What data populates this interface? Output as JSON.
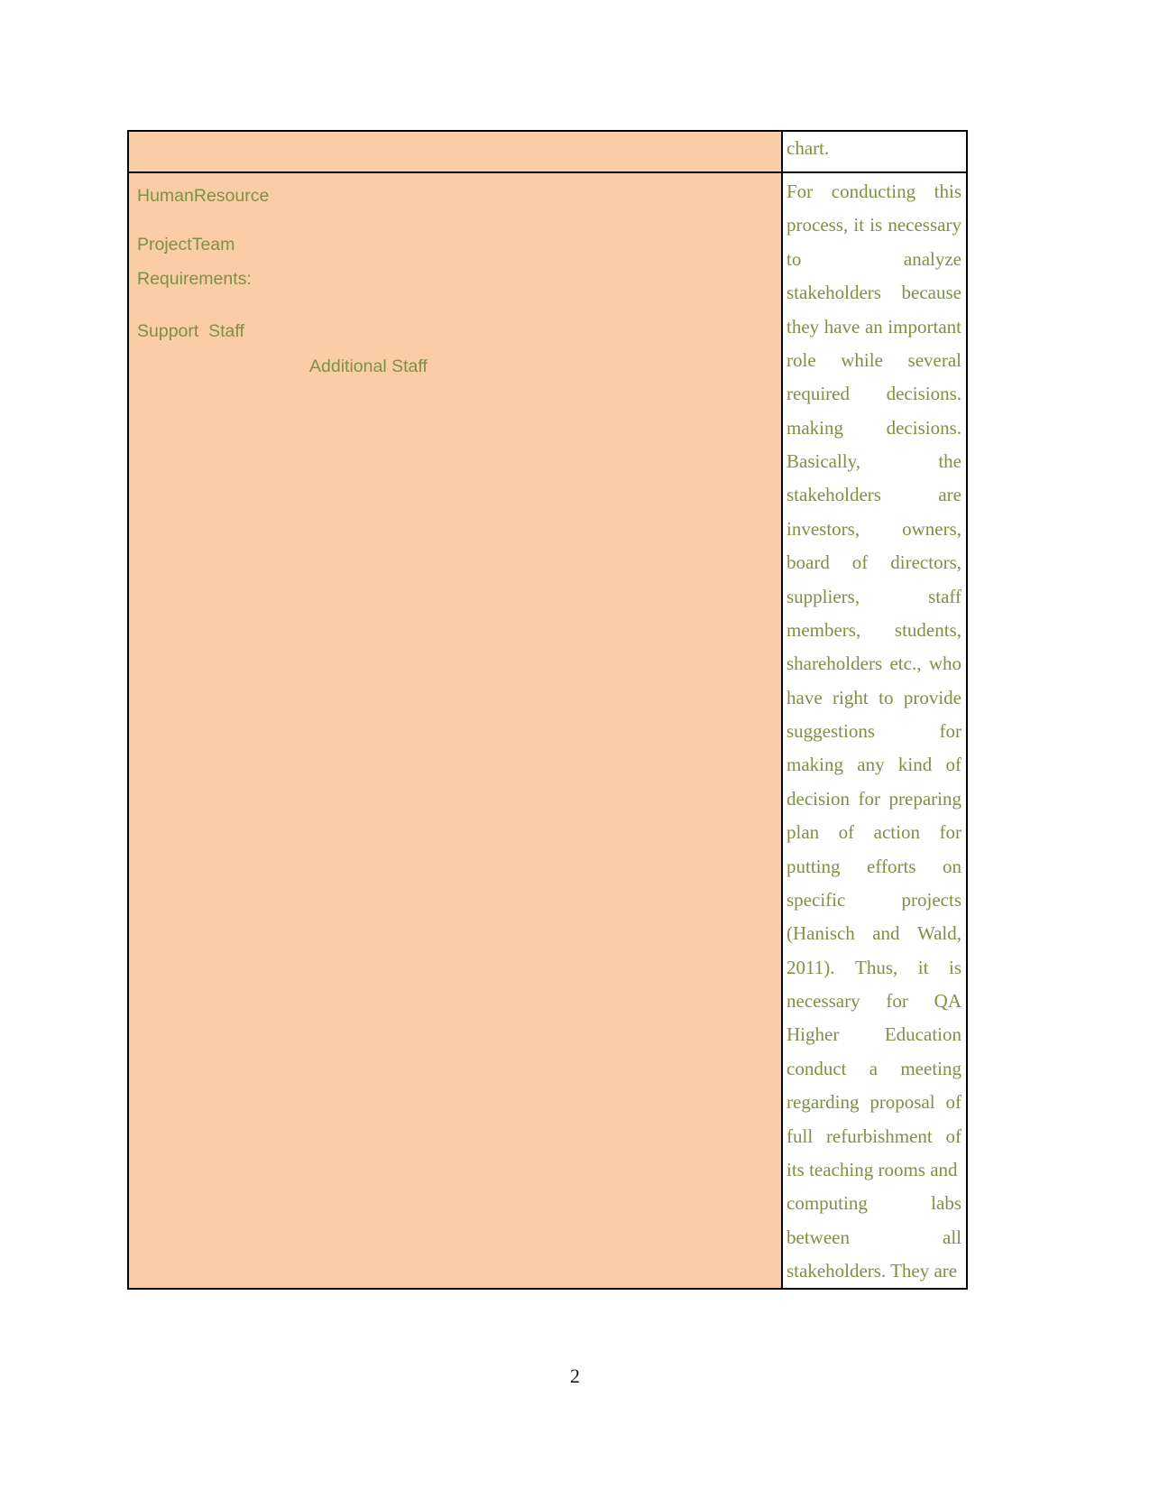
{
  "document": {
    "page_number": "2",
    "colors": {
      "cell_fill": "#facda7",
      "text_green": "#7e9045",
      "border": "#000000",
      "page_background": "#ffffff"
    }
  },
  "table": {
    "rows": [
      {
        "row_name": "header-row",
        "left_cell": {
          "text": ""
        },
        "right_cell": {
          "lines": [
            "chart."
          ]
        }
      },
      {
        "row_name": "body-row",
        "left_cell": {
          "entries": [
            {
              "label_a": "Human",
              "label_b": "Resource"
            },
            {
              "label_a": "Project",
              "label_b": "Team"
            },
            {
              "label_a": "Requirements:",
              "label_b": ""
            },
            {
              "label_a": "Support  Staff",
              "label_b": ""
            },
            {
              "label_a": "",
              "label_b": "Additional Staff"
            }
          ],
          "line_1": "Human",
          "line_1b": "Resource",
          "line_2": "Project",
          "line_2b": "Team",
          "line_3": "Requirements:",
          "line_4": "Support  Staff",
          "line_5": "Additional Staff"
        },
        "right_cell": {
          "paragraph": "For conducting this process, it is necessary to analyze stakeholders because they have an important role while several required decisions. making decisions. Basically, the stakeholders are investors, owners, board of directors, suppliers, staff members, students, shareholders etc., who have right to provide suggestions for making any kind of decision for preparing plan of action for putting efforts on specific projects (Hanisch and Wald, 2011). Thus, it is necessary for QA Higher Education conduct a meeting regarding proposal of full refurbishment of its teaching rooms and computing labs between all stakeholders. They are",
          "lines": [
            [
              "For",
              "conducting",
              "this"
            ],
            [
              "process,",
              "it",
              "is",
              "necessary"
            ],
            [
              "to",
              "analyze"
            ],
            [
              "stakeholders",
              "because"
            ],
            [
              "they",
              "have",
              "an",
              "important"
            ],
            [
              "role",
              "while",
              "several"
            ],
            [
              "required",
              "decisions."
            ],
            [
              "making",
              "decisions."
            ],
            [
              "Basically,",
              "the"
            ],
            [
              "stakeholders",
              "are"
            ],
            [
              "investors,",
              "owners,"
            ],
            [
              "board",
              "of",
              "directors,"
            ],
            [
              "suppliers,",
              "staff"
            ],
            [
              "members,",
              "students,"
            ],
            [
              "shareholders",
              "etc.,",
              "who"
            ],
            [
              "have",
              "right",
              "to",
              "provide"
            ],
            [
              "suggestions",
              "for"
            ],
            [
              "making",
              "any",
              "kind",
              "of"
            ],
            [
              "decision",
              "for",
              "preparing"
            ],
            [
              "plan",
              "of",
              "action",
              "for"
            ],
            [
              "putting",
              "efforts",
              "on"
            ],
            [
              "specific",
              "projects"
            ],
            [
              "(Hanisch",
              "and",
              "Wald,"
            ],
            [
              "2011).",
              "Thus,",
              "it",
              "is"
            ],
            [
              "necessary",
              "for",
              "QA"
            ],
            [
              "Higher",
              "Education"
            ],
            [
              "conduct",
              "a",
              "meeting"
            ],
            [
              "regarding",
              "proposal",
              "of"
            ],
            [
              "full",
              "refurbishment",
              "of"
            ],
            [
              "its teaching rooms and"
            ],
            [
              "computing",
              "labs"
            ],
            [
              "between",
              "all"
            ],
            [
              "stakeholders. They are"
            ]
          ]
        }
      }
    ]
  }
}
